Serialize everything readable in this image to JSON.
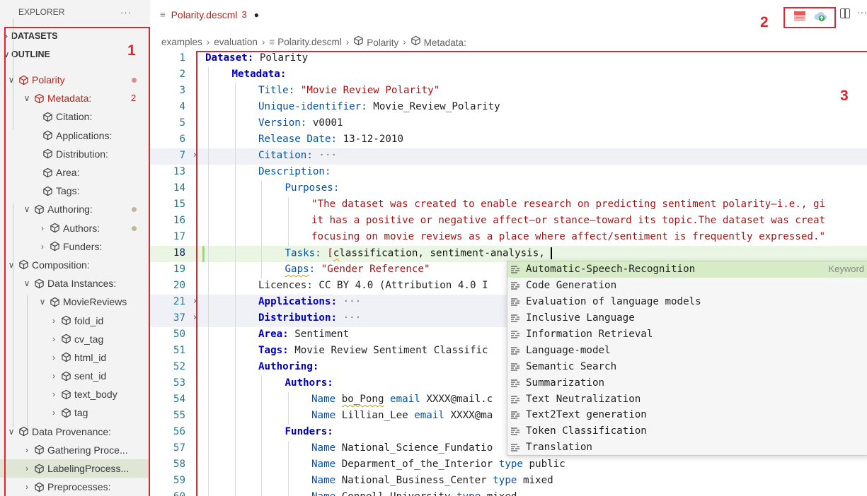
{
  "explorer": {
    "title": "EXPLORER",
    "more": "···",
    "sections": [
      {
        "label": "DATASETS",
        "chevron": "›"
      },
      {
        "label": "OUTLINE",
        "chevron": "∨"
      }
    ],
    "outline": [
      {
        "label": "Polarity",
        "level": 0,
        "twisty": "∨",
        "style": "red",
        "badge": "dot-red"
      },
      {
        "label": "Metadata:",
        "level": 1,
        "twisty": "∨",
        "style": "red",
        "badge": "2"
      },
      {
        "label": "Citation:",
        "level": 2,
        "twisty": ""
      },
      {
        "label": "Applications:",
        "level": 2,
        "twisty": ""
      },
      {
        "label": "Distribution:",
        "level": 2,
        "twisty": ""
      },
      {
        "label": "Area:",
        "level": 2,
        "twisty": ""
      },
      {
        "label": "Tags:",
        "level": 2,
        "twisty": ""
      },
      {
        "label": "Authoring:",
        "level": 1,
        "twisty": "∨",
        "badge": "dot"
      },
      {
        "label": "Authors:",
        "level": 2,
        "twisty": "›",
        "badge": "dot"
      },
      {
        "label": "Funders:",
        "level": 2,
        "twisty": "›"
      },
      {
        "label": "Composition:",
        "level": 0,
        "twisty": "∨"
      },
      {
        "label": "Data Instances:",
        "level": 1,
        "twisty": "∨"
      },
      {
        "label": "MovieReviews",
        "level": 2,
        "twisty": "∨"
      },
      {
        "label": "fold_id",
        "level": 3,
        "twisty": "›"
      },
      {
        "label": "cv_tag",
        "level": 3,
        "twisty": "›"
      },
      {
        "label": "html_id",
        "level": 3,
        "twisty": "›"
      },
      {
        "label": "sent_id",
        "level": 3,
        "twisty": "›"
      },
      {
        "label": "text_body",
        "level": 3,
        "twisty": "›"
      },
      {
        "label": "tag",
        "level": 3,
        "twisty": "›"
      },
      {
        "label": "Data Provenance:",
        "level": 0,
        "twisty": "∨"
      },
      {
        "label": "Gathering Proce...",
        "level": 1,
        "twisty": "›"
      },
      {
        "label": "LabelingProcess...",
        "level": 1,
        "twisty": "›",
        "selected": true
      },
      {
        "label": "Preprocesses:",
        "level": 1,
        "twisty": "›"
      }
    ]
  },
  "annotations": {
    "one": "1",
    "two": "2",
    "three": "3"
  },
  "tab": {
    "icon": "≡",
    "name": "Polarity.descml",
    "problems": "3",
    "dirty": "●"
  },
  "toolbar": {
    "more": "···"
  },
  "breadcrumb": {
    "items": [
      "examples",
      "evaluation",
      "Polarity.descml",
      "Polarity",
      "Metadata:"
    ],
    "separator": "›"
  },
  "editor": {
    "lines": [
      {
        "n": "1",
        "indent": 0,
        "parts": [
          {
            "t": "Dataset: ",
            "c": "k-bold"
          },
          {
            "t": "Polarity",
            "c": "v-plain"
          }
        ]
      },
      {
        "n": "2",
        "indent": 1,
        "parts": [
          {
            "t": "Metadata:",
            "c": "k-bold"
          }
        ]
      },
      {
        "n": "3",
        "indent": 2,
        "parts": [
          {
            "t": "Title: ",
            "c": "k-blue"
          },
          {
            "t": "\"Movie Review Polarity\"",
            "c": "v-str"
          }
        ]
      },
      {
        "n": "4",
        "indent": 2,
        "parts": [
          {
            "t": "Unique-identifier: ",
            "c": "k-blue"
          },
          {
            "t": "Movie_Review_Polarity",
            "c": "v-plain"
          }
        ]
      },
      {
        "n": "5",
        "indent": 2,
        "parts": [
          {
            "t": "Version: ",
            "c": "k-blue"
          },
          {
            "t": "v0001",
            "c": "v-plain"
          }
        ]
      },
      {
        "n": "6",
        "indent": 2,
        "parts": [
          {
            "t": "Release Date: ",
            "c": "k-blue"
          },
          {
            "t": "13-12-2010",
            "c": "v-plain"
          }
        ]
      },
      {
        "n": "7",
        "indent": 2,
        "fold": "›",
        "folded": true,
        "parts": [
          {
            "t": "Citation: ",
            "c": "k-blue"
          },
          {
            "t": "···",
            "c": "v-ell"
          }
        ]
      },
      {
        "n": "13",
        "indent": 2,
        "parts": [
          {
            "t": "Description:",
            "c": "k-blue"
          }
        ]
      },
      {
        "n": "14",
        "indent": 3,
        "parts": [
          {
            "t": "Purposes:",
            "c": "k-blue"
          }
        ]
      },
      {
        "n": "15",
        "indent": 4,
        "parts": [
          {
            "t": "\"The dataset was created to enable research on predicting sentiment polarity—i.e., gi",
            "c": "v-str"
          }
        ]
      },
      {
        "n": "16",
        "indent": 4,
        "parts": [
          {
            "t": "it has a positive or negative affect—or stance—toward its topic.The dataset was creat",
            "c": "v-str"
          }
        ]
      },
      {
        "n": "17",
        "indent": 4,
        "parts": [
          {
            "t": "focusing on movie reviews as a place where affect/sentiment is frequently expressed.\"",
            "c": "v-str"
          }
        ]
      },
      {
        "n": "18",
        "indent": 3,
        "current": true,
        "parts": [
          {
            "t": "Tasks: ",
            "c": "k-blue"
          },
          {
            "t": "[",
            "c": "v-str"
          },
          {
            "t": "c",
            "c": "v-dark squig"
          },
          {
            "t": "lassification, sentiment-analysis, ",
            "c": "v-dark"
          },
          {
            "t": "",
            "c": "cursor"
          }
        ]
      },
      {
        "n": "19",
        "indent": 3,
        "parts": [
          {
            "t": "Gaps",
            "c": "k-blue squig"
          },
          {
            "t": ": ",
            "c": "k-blue"
          },
          {
            "t": "\"Gender Reference\"",
            "c": "v-str"
          }
        ]
      },
      {
        "n": "20",
        "indent": 2,
        "parts": [
          {
            "t": "Licences: CC BY 4.0 (Attribution 4.0 I",
            "c": "v-plain"
          }
        ]
      },
      {
        "n": "21",
        "indent": 2,
        "fold": "›",
        "folded": true,
        "parts": [
          {
            "t": "Applications: ",
            "c": "k-bold"
          },
          {
            "t": "···",
            "c": "v-ell"
          }
        ]
      },
      {
        "n": "37",
        "indent": 2,
        "fold": "›",
        "folded": true,
        "parts": [
          {
            "t": "Distribution: ",
            "c": "k-bold"
          },
          {
            "t": "···",
            "c": "v-ell"
          }
        ]
      },
      {
        "n": "50",
        "indent": 2,
        "parts": [
          {
            "t": "Area: ",
            "c": "k-bold"
          },
          {
            "t": "Sentiment",
            "c": "v-plain"
          }
        ]
      },
      {
        "n": "51",
        "indent": 2,
        "parts": [
          {
            "t": "Tags: ",
            "c": "k-bold"
          },
          {
            "t": "Movie Review Sentiment Classific",
            "c": "v-plain"
          }
        ]
      },
      {
        "n": "52",
        "indent": 2,
        "parts": [
          {
            "t": "Authoring:",
            "c": "k-bold"
          }
        ]
      },
      {
        "n": "53",
        "indent": 3,
        "parts": [
          {
            "t": "Authors:",
            "c": "k-bold"
          }
        ]
      },
      {
        "n": "54",
        "indent": 4,
        "parts": [
          {
            "t": "Name ",
            "c": "k-blue"
          },
          {
            "t": "bo_Pong",
            "c": "v-plain squig"
          },
          {
            "t": " email ",
            "c": "k-blue"
          },
          {
            "t": "XXXX@mail.c",
            "c": "v-plain"
          }
        ]
      },
      {
        "n": "55",
        "indent": 4,
        "parts": [
          {
            "t": "Name ",
            "c": "k-blue"
          },
          {
            "t": "Lillian_Lee",
            "c": "v-plain"
          },
          {
            "t": " email ",
            "c": "k-blue"
          },
          {
            "t": "XXXX@ma",
            "c": "v-plain"
          }
        ]
      },
      {
        "n": "56",
        "indent": 3,
        "parts": [
          {
            "t": "Funders:",
            "c": "k-bold"
          }
        ]
      },
      {
        "n": "57",
        "indent": 4,
        "parts": [
          {
            "t": "Name ",
            "c": "k-blue"
          },
          {
            "t": "National_Science_Fundatio",
            "c": "v-plain"
          }
        ]
      },
      {
        "n": "58",
        "indent": 4,
        "parts": [
          {
            "t": "Name ",
            "c": "k-blue"
          },
          {
            "t": "Deparment_of_the_Interior",
            "c": "v-plain"
          },
          {
            "t": " type ",
            "c": "k-blue"
          },
          {
            "t": "public",
            "c": "v-plain"
          }
        ]
      },
      {
        "n": "59",
        "indent": 4,
        "parts": [
          {
            "t": "Name ",
            "c": "k-blue"
          },
          {
            "t": "National_Business_Center",
            "c": "v-plain"
          },
          {
            "t": " type ",
            "c": "k-blue"
          },
          {
            "t": "mixed",
            "c": "v-plain"
          }
        ]
      },
      {
        "n": "60",
        "indent": 4,
        "parts": [
          {
            "t": "Name ",
            "c": "k-blue"
          },
          {
            "t": "Connell_University",
            "c": "v-plain"
          },
          {
            "t": " type ",
            "c": "k-blue"
          },
          {
            "t": "mixed",
            "c": "v-plain"
          }
        ]
      }
    ]
  },
  "suggestions": {
    "kind_label": "Keyword",
    "items": [
      "Automatic-Speech-Recognition",
      "Code Generation",
      "Evaluation of language models",
      "Inclusive Language",
      "Information Retrieval",
      "Language-model",
      "Semantic Search",
      "Summarization",
      "Text Neutralization",
      "Text2Text generation",
      "Token Classification",
      "Translation"
    ]
  }
}
